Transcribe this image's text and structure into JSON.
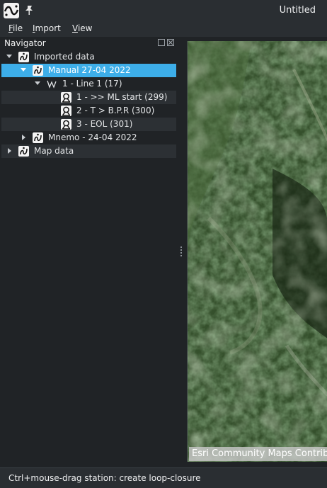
{
  "window": {
    "title": "Untitled"
  },
  "menu": [
    {
      "label": "File"
    },
    {
      "label": "Import"
    },
    {
      "label": "View"
    }
  ],
  "navigator": {
    "title": "Navigator",
    "tree": [
      {
        "label": "Imported data",
        "icon": "dataset-icon",
        "expanded": true
      },
      {
        "label": "Manual 27-04 2022",
        "icon": "dataset-icon",
        "expanded": true,
        "selected": true
      },
      {
        "label": "1 - Line 1 (17)",
        "icon": "line-icon",
        "expanded": true
      },
      {
        "label": "1 - >> ML start (299)",
        "icon": "station-icon"
      },
      {
        "label": "2 - T > B.P.R (300)",
        "icon": "station-icon"
      },
      {
        "label": "3 - EOL (301)",
        "icon": "station-icon"
      },
      {
        "label": "Mnemo - 24-04 2022",
        "icon": "dataset-icon",
        "expanded": false
      },
      {
        "label": "Map data",
        "icon": "dataset-icon",
        "expanded": false
      }
    ]
  },
  "map": {
    "attribution": "Esri Community Maps Contribu"
  },
  "status": {
    "text": "Ctrl+mouse-drag station: create loop-closure"
  }
}
